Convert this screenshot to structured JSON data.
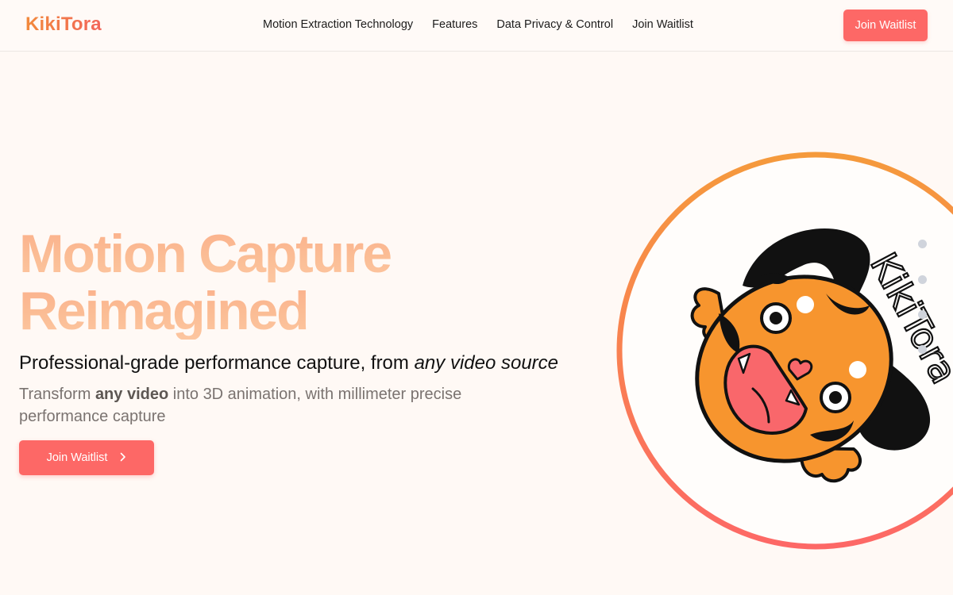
{
  "header": {
    "logo": "KikiTora",
    "nav": [
      "Motion Extraction Technology",
      "Features",
      "Data Privacy & Control",
      "Join Waitlist"
    ],
    "cta_label": "Join Waitlist"
  },
  "hero": {
    "title_line1": "Motion Capture",
    "title_line2": "Reimagined",
    "subtitle_prefix": "Professional-grade performance capture, from ",
    "subtitle_emphasis": "any video source",
    "desc_prefix": "Transform ",
    "desc_bold": "any video",
    "desc_suffix": " into 3D animation, with millimeter precise performance capture",
    "cta_label": "Join Waitlist",
    "cta_icon": "chevron-right-icon"
  },
  "illustration": {
    "mascot_text": "KikiTora",
    "ring_colors": [
      "#f59a3c",
      "#fd6866"
    ],
    "mascot_color": "#f7952e"
  },
  "colors": {
    "accent": "#fd6866",
    "background": "#fff9f5"
  }
}
